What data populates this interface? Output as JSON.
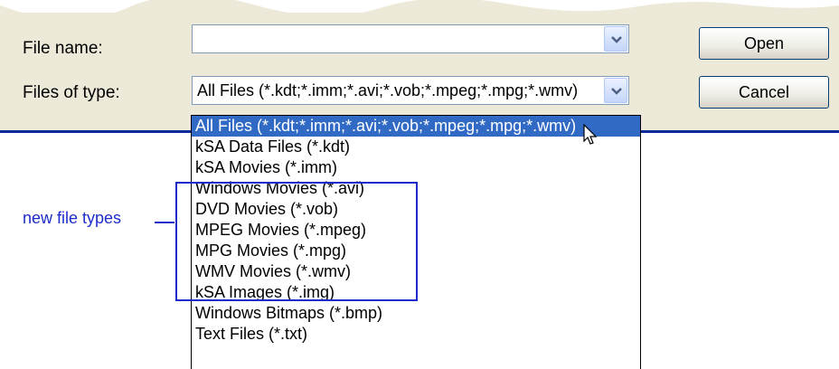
{
  "dialog": {
    "file_name_label": "File name:",
    "file_name_value": "",
    "files_of_type_label": "Files of type:",
    "files_of_type_value": "All Files (*.kdt;*.imm;*.avi;*.vob;*.mpeg;*.mpg;*.wmv)",
    "open_label": "Open",
    "cancel_label": "Cancel"
  },
  "dropdown": {
    "selected_index": 0,
    "items": [
      "All Files (*.kdt;*.imm;*.avi;*.vob;*.mpeg;*.mpg;*.wmv)",
      "kSA Data Files (*.kdt)",
      "kSA Movies (*.imm)",
      "Windows Movies (*.avi)",
      "DVD Movies (*.vob)",
      "MPEG Movies (*.mpeg)",
      "MPG Movies (*.mpg)",
      "WMV Movies (*.wmv)",
      "kSA Images (*.img)",
      "Windows Bitmaps (*.bmp)",
      "Text Files (*.txt)"
    ]
  },
  "annotation": {
    "label": "new file types",
    "color": "#1c2bc9"
  },
  "colors": {
    "dialog_bg": "#ece9d8",
    "selection": "#316ac5",
    "accent_line": "#0a2a9c"
  },
  "icons": [
    "chevron-down-icon",
    "mouse-cursor-icon"
  ]
}
